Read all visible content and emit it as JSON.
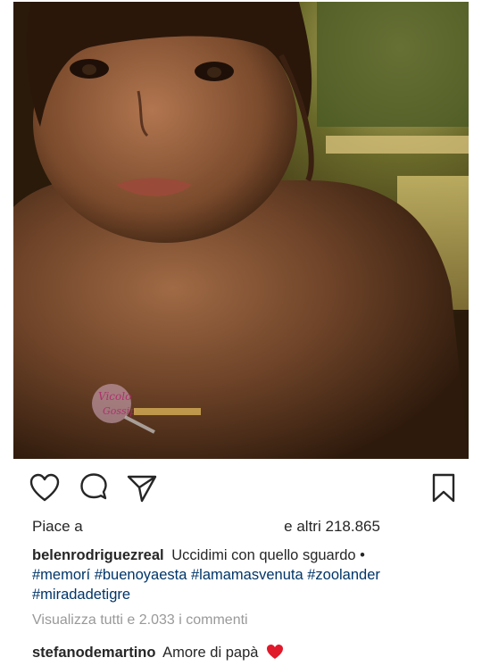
{
  "photo": {
    "subject": "portrait-photo",
    "watermark_text": "Vicolo Gossip"
  },
  "actions": {
    "like_icon": "heart-outline-icon",
    "comment_icon": "comment-bubble-icon",
    "share_icon": "paper-plane-icon",
    "save_icon": "bookmark-icon"
  },
  "likes": {
    "prefix": "Piace a",
    "suffix": "e altri",
    "count": "218.865"
  },
  "caption": {
    "username": "belenrodriguezreal",
    "text": "Uccidimi con quello sguardo •",
    "hashtags": [
      "#memorí",
      "#buenoyaesta",
      "#lamamasvenuta",
      "#zoolander",
      "#miradadetigre"
    ]
  },
  "comments": {
    "view_all": "Visualizza tutti e 2.033 i commenti",
    "first": {
      "username": "stefanodemartino",
      "text": "Amore di papà",
      "emoji": "red-heart-icon"
    }
  },
  "colors": {
    "text": "#262626",
    "hashtag": "#003569",
    "muted": "#999999",
    "heart": "#e0192b"
  }
}
